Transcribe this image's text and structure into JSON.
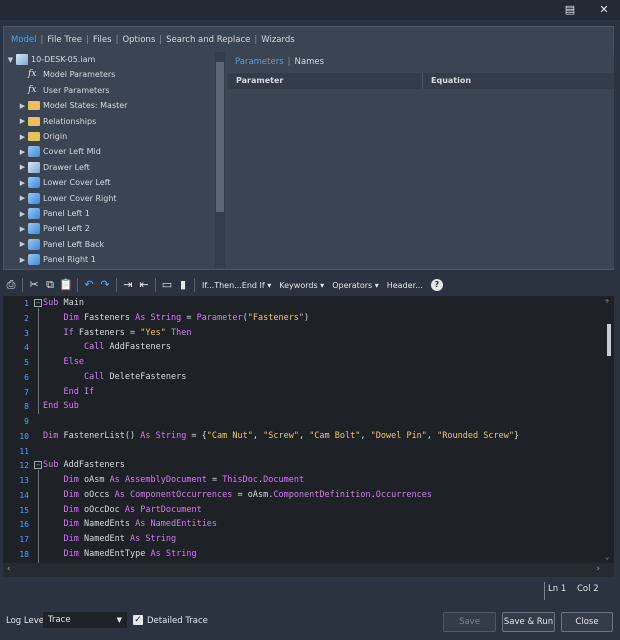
{
  "window": {
    "help_icon": "question-icon",
    "close_icon": "close-icon"
  },
  "tabs": [
    "Model",
    "File Tree",
    "Files",
    "Options",
    "Search and Replace",
    "Wizards"
  ],
  "tree": [
    {
      "label": "10-DESK-05.iam",
      "icon": "assembly-icon",
      "indent": 0,
      "expander": "down"
    },
    {
      "label": "Model Parameters",
      "icon": "fx-icon",
      "indent": 1,
      "expander": ""
    },
    {
      "label": "User Parameters",
      "icon": "fx-icon",
      "indent": 1,
      "expander": ""
    },
    {
      "label": "Model States: Master",
      "icon": "folder-icon",
      "indent": 1,
      "expander": "right"
    },
    {
      "label": "Relationships",
      "icon": "folder-icon",
      "indent": 1,
      "expander": "right"
    },
    {
      "label": "Origin",
      "icon": "folder-icon",
      "indent": 1,
      "expander": "right"
    },
    {
      "label": "Cover Left Mid",
      "icon": "part-icon",
      "indent": 1,
      "expander": "right"
    },
    {
      "label": "Drawer Left",
      "icon": "assembly-icon",
      "indent": 1,
      "expander": "right"
    },
    {
      "label": "Lower Cover Left",
      "icon": "part-icon",
      "indent": 1,
      "expander": "right"
    },
    {
      "label": "Lower Cover Right",
      "icon": "part-icon",
      "indent": 1,
      "expander": "right"
    },
    {
      "label": "Panel Left 1",
      "icon": "part-icon",
      "indent": 1,
      "expander": "right"
    },
    {
      "label": "Panel Left 2",
      "icon": "part-icon",
      "indent": 1,
      "expander": "right"
    },
    {
      "label": "Panel Left Back",
      "icon": "part-icon",
      "indent": 1,
      "expander": "right"
    },
    {
      "label": "Panel Right 1",
      "icon": "part-icon",
      "indent": 1,
      "expander": "right"
    }
  ],
  "param_tabs": [
    "Parameters",
    "Names"
  ],
  "param_columns": [
    "Parameter",
    "Equation"
  ],
  "toolbar": {
    "menus": [
      "If...Then...End If ▾",
      "Keywords ▾",
      "Operators ▾",
      "Header..."
    ]
  },
  "code_lines": [
    {
      "n": "1",
      "fold": "−",
      "html": "<span class=\"kw\">Sub</span> Main"
    },
    {
      "n": "2",
      "fold": "",
      "html": "    <span class=\"kw\">Dim</span> Fasteners <span class=\"kw\">As String</span> = <span class=\"kw\">Parameter</span>(<span class=\"str\">\"Fasteners\"</span>)"
    },
    {
      "n": "3",
      "fold": "",
      "html": "    <span class=\"kw\">If</span> Fasteners = <span class=\"str\">\"Yes\"</span> <span class=\"kw\">Then</span>"
    },
    {
      "n": "4",
      "fold": "",
      "html": "        <span class=\"kw\">Call</span> AddFasteners"
    },
    {
      "n": "5",
      "fold": "",
      "html": "    <span class=\"kw\">Else</span>"
    },
    {
      "n": "6",
      "fold": "",
      "html": "        <span class=\"kw\">Call</span> DeleteFasteners"
    },
    {
      "n": "7",
      "fold": "",
      "html": "    <span class=\"kw\">End If</span>"
    },
    {
      "n": "8",
      "fold": "",
      "html": "<span class=\"kw\">End Sub</span>"
    },
    {
      "n": "9",
      "fold": "",
      "html": ""
    },
    {
      "n": "10",
      "fold": "",
      "html": "<span class=\"kw\">Dim</span> FastenerList() <span class=\"kw\">As String</span> = {<span class=\"str\">\"Cam Nut\"</span>, <span class=\"str\">\"Screw\"</span>, <span class=\"str\">\"Cam Bolt\"</span>, <span class=\"str\">\"Dowel Pin\"</span>, <span class=\"str\">\"Rounded Screw\"</span>}"
    },
    {
      "n": "11",
      "fold": "",
      "html": ""
    },
    {
      "n": "12",
      "fold": "−",
      "html": "<span class=\"kw\">Sub</span> AddFasteners"
    },
    {
      "n": "13",
      "fold": "",
      "html": "    <span class=\"kw\">Dim</span> oAsm <span class=\"kw\">As</span> <span class=\"kw\">AssemblyDocument</span> = <span class=\"kw\">ThisDoc</span>.<span class=\"kw\">Document</span>"
    },
    {
      "n": "14",
      "fold": "",
      "html": "    <span class=\"kw\">Dim</span> oOccs <span class=\"kw\">As</span> <span class=\"kw\">ComponentOccurrences</span> = oAsm.<span class=\"kw\">ComponentDefinition</span>.<span class=\"kw\">Occurrences</span>"
    },
    {
      "n": "15",
      "fold": "",
      "html": "    <span class=\"kw\">Dim</span> oOccDoc <span class=\"kw\">As</span> <span class=\"kw\">PartDocument</span>"
    },
    {
      "n": "16",
      "fold": "",
      "html": "    <span class=\"kw\">Dim</span> NamedEnts <span class=\"kw\">As</span> <span class=\"kw\">NamedEntities</span>"
    },
    {
      "n": "17",
      "fold": "",
      "html": "    <span class=\"kw\">Dim</span> NamedEnt <span class=\"kw\">As String</span>"
    },
    {
      "n": "18",
      "fold": "",
      "html": "    <span class=\"kw\">Dim</span> NamedEntType <span class=\"kw\">As String</span>"
    }
  ],
  "status": {
    "line": "Ln 1",
    "col": "Col 2"
  },
  "bottom": {
    "log_level_label": "Log Level",
    "log_level_value": "Trace",
    "detailed_trace_label": "Detailed Trace",
    "save": "Save",
    "save_run": "Save & Run",
    "close": "Close"
  }
}
